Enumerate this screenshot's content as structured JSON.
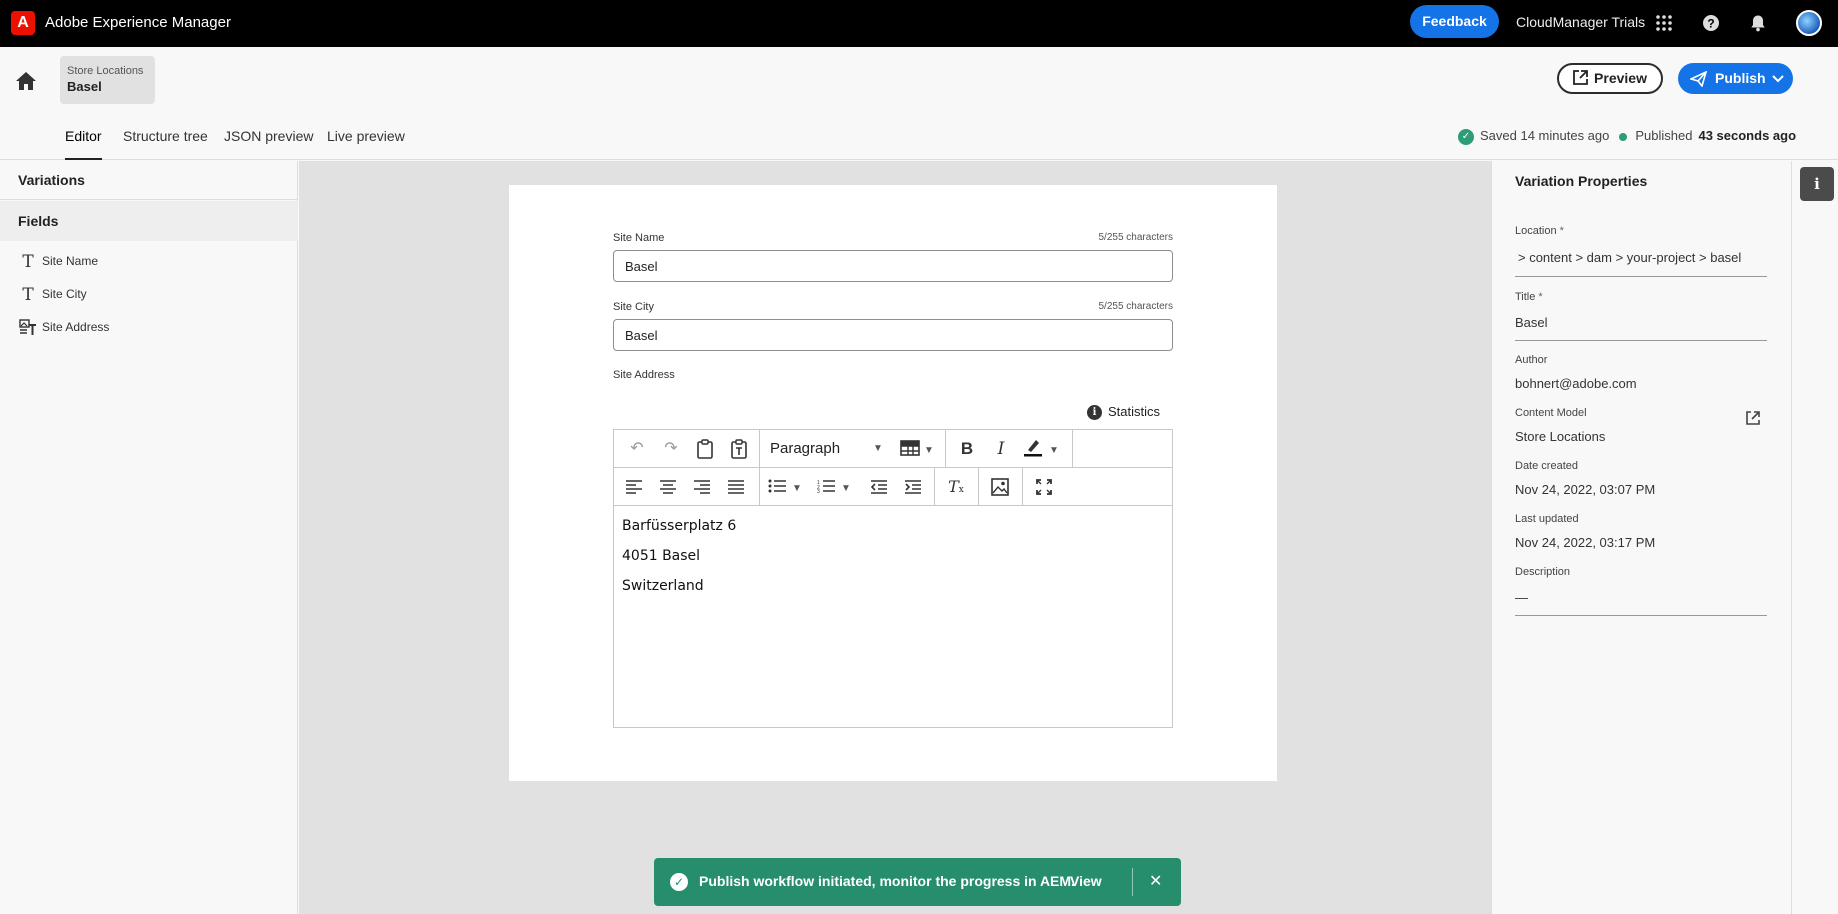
{
  "topbar": {
    "logo_glyph": "A",
    "app_title": "Adobe Experience Manager",
    "feedback_label": "Feedback",
    "org_name": "CloudManager Trials",
    "apps_icon": "apps-grid-icon",
    "help_icon": "help-icon",
    "notifications_icon": "bell-icon"
  },
  "header": {
    "breadcrumb": {
      "parent": "Store Locations",
      "current": "Basel"
    },
    "preview_label": "Preview",
    "publish_label": "Publish",
    "tabs": [
      {
        "label": "Editor",
        "active": true
      },
      {
        "label": "Structure tree",
        "active": false
      },
      {
        "label": "JSON preview",
        "active": false
      },
      {
        "label": "Live preview",
        "active": false
      }
    ],
    "status": {
      "saved_text": "Saved 14 minutes ago",
      "published_label": "Published",
      "published_time": "43 seconds ago"
    }
  },
  "left_panel": {
    "variations_label": "Variations",
    "fields_label": "Fields",
    "fields": [
      {
        "label": "Site Name",
        "icon": "text-icon"
      },
      {
        "label": "Site City",
        "icon": "text-icon"
      },
      {
        "label": "Site Address",
        "icon": "rich-text-icon"
      }
    ]
  },
  "editor": {
    "site_name": {
      "label": "Site Name",
      "count": "5/255 characters",
      "value": "Basel"
    },
    "site_city": {
      "label": "Site City",
      "count": "5/255 characters",
      "value": "Basel"
    },
    "site_address": {
      "label": "Site Address",
      "statistics_label": "Statistics",
      "block_format": "Paragraph",
      "lines": [
        "Barfüsserplatz 6",
        "4051 Basel",
        "Switzerland"
      ]
    }
  },
  "toast": {
    "message": "Publish workflow initiated, monitor the progress in AEM.",
    "action": "View",
    "color": "#268e6c"
  },
  "right_panel": {
    "title": "Variation Properties",
    "location": {
      "label": "Location",
      "value": "> content > dam > your-project > basel"
    },
    "title_field": {
      "label": "Title",
      "value": "Basel"
    },
    "author": {
      "label": "Author",
      "value": "bohnert@adobe.com"
    },
    "content_model": {
      "label": "Content Model",
      "value": "Store Locations"
    },
    "date_created": {
      "label": "Date created",
      "value": "Nov 24, 2022, 03:07 PM"
    },
    "last_updated": {
      "label": "Last updated",
      "value": "Nov 24, 2022, 03:17 PM"
    },
    "description": {
      "label": "Description",
      "value": "—"
    },
    "required_mark": "*"
  },
  "colors": {
    "accent": "#1473e6",
    "brand": "#eb1000",
    "success": "#2d9d78"
  }
}
